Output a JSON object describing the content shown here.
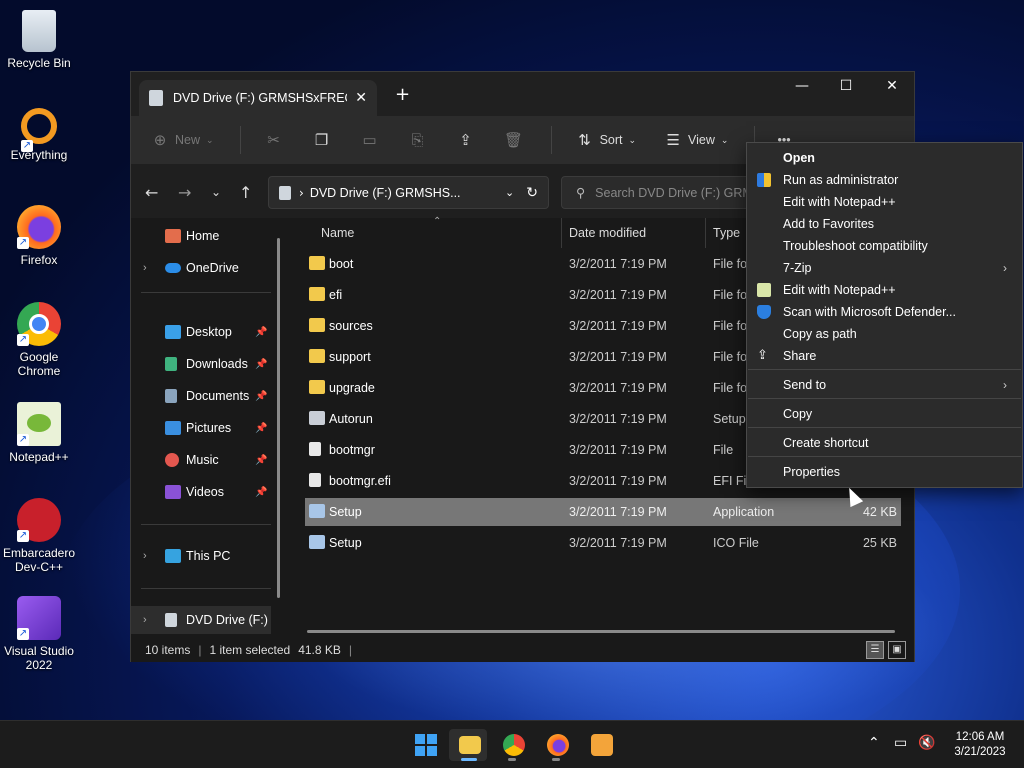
{
  "desktop": {
    "icons": [
      {
        "label": "Recycle Bin"
      },
      {
        "label": "Everything"
      },
      {
        "label": "Firefox"
      },
      {
        "label": "Google Chrome"
      },
      {
        "label": "Notepad++"
      },
      {
        "label": "Embarcadero Dev-C++"
      },
      {
        "label": "Visual Studio 2022"
      }
    ]
  },
  "window": {
    "tab_title": "DVD Drive (F:) GRMSHSxFREO",
    "tab_close": "✕",
    "new_tab": "+",
    "controls": {
      "minimize": "—",
      "maximize": "☐",
      "close": "✕"
    }
  },
  "toolbar": {
    "new_label": "New",
    "sort_label": "Sort",
    "view_label": "View",
    "more_label": "•••"
  },
  "address": {
    "path": "DVD Drive (F:) GRMSHS...",
    "search_placeholder": "Search DVD Drive (F:) GRMS"
  },
  "nav": {
    "items": [
      {
        "label": "Home"
      },
      {
        "label": "OneDrive"
      },
      {
        "label": "Desktop"
      },
      {
        "label": "Downloads"
      },
      {
        "label": "Documents"
      },
      {
        "label": "Pictures"
      },
      {
        "label": "Music"
      },
      {
        "label": "Videos"
      },
      {
        "label": "This PC"
      },
      {
        "label": "DVD Drive (F:) G"
      }
    ]
  },
  "files": {
    "columns": {
      "name": "Name",
      "date": "Date modified",
      "type": "Type"
    },
    "rows": [
      {
        "name": "boot",
        "date": "3/2/2011 7:19 PM",
        "type": "File folder",
        "size": ""
      },
      {
        "name": "efi",
        "date": "3/2/2011 7:19 PM",
        "type": "File folder",
        "size": ""
      },
      {
        "name": "sources",
        "date": "3/2/2011 7:19 PM",
        "type": "File folder",
        "size": ""
      },
      {
        "name": "support",
        "date": "3/2/2011 7:19 PM",
        "type": "File folder",
        "size": ""
      },
      {
        "name": "upgrade",
        "date": "3/2/2011 7:19 PM",
        "type": "File folder",
        "size": ""
      },
      {
        "name": "Autorun",
        "date": "3/2/2011 7:19 PM",
        "type": "Setup Information",
        "size": ""
      },
      {
        "name": "bootmgr",
        "date": "3/2/2011 7:19 PM",
        "type": "File",
        "size": ""
      },
      {
        "name": "bootmgr.efi",
        "date": "3/2/2011 7:19 PM",
        "type": "EFI File",
        "size": ""
      },
      {
        "name": "Setup",
        "date": "3/2/2011 7:19 PM",
        "type": "Application",
        "size": "42 KB"
      },
      {
        "name": "Setup",
        "date": "3/2/2011 7:19 PM",
        "type": "ICO File",
        "size": "25 KB"
      }
    ]
  },
  "status": {
    "items_count": "10 items",
    "selected": "1 item selected",
    "size": "41.8 KB"
  },
  "context_menu": {
    "items": [
      {
        "label": "Open"
      },
      {
        "label": "Run as administrator"
      },
      {
        "label": "Edit with Notepad++"
      },
      {
        "label": "Add to Favorites"
      },
      {
        "label": "Troubleshoot compatibility"
      },
      {
        "label": "7-Zip"
      },
      {
        "label": "Edit with Notepad++"
      },
      {
        "label": "Scan with Microsoft Defender..."
      },
      {
        "label": "Copy as path"
      },
      {
        "label": "Share"
      },
      {
        "label": "Send to"
      },
      {
        "label": "Copy"
      },
      {
        "label": "Create shortcut"
      },
      {
        "label": "Properties"
      }
    ]
  },
  "taskbar": {
    "time": "12:06 AM",
    "date": "3/21/2023"
  },
  "colors": {
    "accent": "#6cb8ff",
    "folder": "#f2c94c",
    "selection": "#777777"
  }
}
